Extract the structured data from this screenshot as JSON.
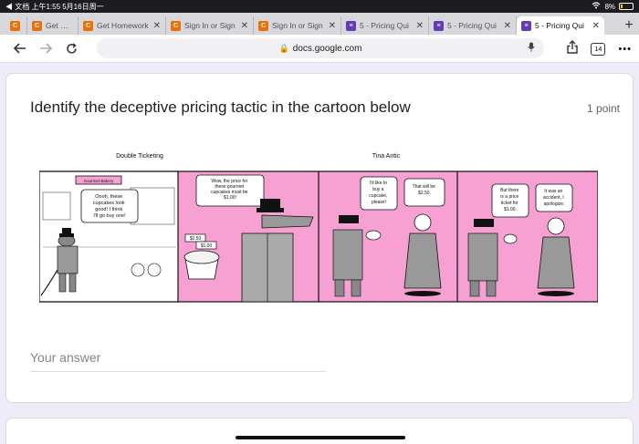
{
  "status": {
    "left_text": "◀ 文档  上午1:55  5月16日周一",
    "battery": "8%"
  },
  "tabs": [
    {
      "label": "",
      "icon": "c-icon",
      "color": "#e8710a"
    },
    {
      "label": "Get Hom",
      "icon": "c-icon",
      "color": "#e8710a"
    },
    {
      "label": "Get Homework",
      "icon": "c-icon",
      "color": "#e8710a"
    },
    {
      "label": "Sign In or Sign",
      "icon": "c-icon",
      "color": "#e8710a"
    },
    {
      "label": "Sign In or Sign",
      "icon": "c-icon",
      "color": "#e8710a"
    },
    {
      "label": "5 - Pricing Qui",
      "icon": "forms-icon",
      "color": "#673ab7"
    },
    {
      "label": "5 - Pricing Qui",
      "icon": "forms-icon",
      "color": "#673ab7"
    },
    {
      "label": "5 - Pricing Qui",
      "icon": "forms-icon",
      "color": "#673ab7"
    }
  ],
  "toolbar": {
    "url": "docs.google.com",
    "tab_count": "14",
    "more": "•••"
  },
  "question": {
    "title": "Identify the deceptive pricing tactic in the cartoon below",
    "points": "1 point"
  },
  "cartoon": {
    "label_left": "Double Ticketing",
    "label_right": "Tina Antic",
    "sign": "Gourmet Bakery",
    "bubble1": [
      "Oooh, these",
      "cupcakes look",
      "good! I think",
      "I'll go buy one!"
    ],
    "bubble2": [
      "Wow, the price for",
      "these gourmet",
      "cupcakes must be",
      "$1.00!"
    ],
    "price_tag1": "$2.50",
    "price_tag2": "$1.00",
    "bubble3": [
      "I'd like to",
      "buy a",
      "cupcake,",
      "please!"
    ],
    "bubble4": [
      "That will be",
      "$2.50."
    ],
    "bubble5": [
      "But there",
      "is a price",
      "ticket for",
      "$1.00."
    ],
    "bubble6": [
      "It was an",
      "accident, I",
      "apologize."
    ],
    "colors": {
      "pink": "#f7a1d2",
      "dark": "#111111"
    }
  },
  "answer": {
    "placeholder": "Your answer"
  }
}
